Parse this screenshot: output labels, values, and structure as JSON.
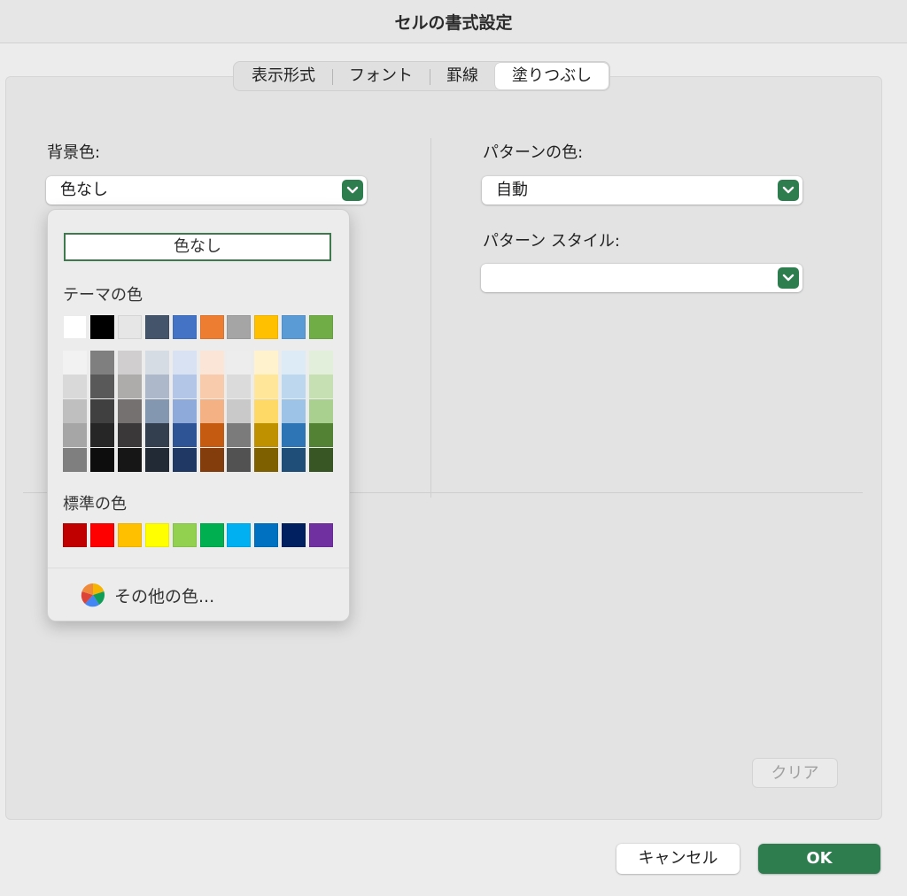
{
  "window": {
    "title": "セルの書式設定"
  },
  "tabs": [
    {
      "label": "表示形式",
      "active": false
    },
    {
      "label": "フォント",
      "active": false
    },
    {
      "label": "罫線",
      "active": false
    },
    {
      "label": "塗りつぶし",
      "active": true
    }
  ],
  "background_color": {
    "label": "背景色:",
    "value": "色なし",
    "popup": {
      "no_color_label": "色なし",
      "theme_colors_label": "テーマの色",
      "theme_colors": [
        "#ffffff",
        "#000000",
        "#e6e6e6",
        "#44546a",
        "#4472c4",
        "#ed7d31",
        "#a5a5a5",
        "#ffc000",
        "#5b9bd5",
        "#70ad47"
      ],
      "theme_shades": [
        [
          "#f2f2f2",
          "#d9d9d9",
          "#bfbfbf",
          "#a6a6a6",
          "#7f7f7f"
        ],
        [
          "#7f7f7f",
          "#595959",
          "#404040",
          "#262626",
          "#0d0d0d"
        ],
        [
          "#d0cece",
          "#aeabab",
          "#757171",
          "#3a3838",
          "#171616"
        ],
        [
          "#d6dce4",
          "#adb9ca",
          "#8497b0",
          "#333f4f",
          "#222a35"
        ],
        [
          "#d9e2f3",
          "#b4c6e7",
          "#8eaadb",
          "#2f5496",
          "#1f3864"
        ],
        [
          "#fbe5d6",
          "#f8cbad",
          "#f4b183",
          "#c55a11",
          "#833c0c"
        ],
        [
          "#ededed",
          "#dbdbdb",
          "#c9c9c9",
          "#7b7b7b",
          "#525252"
        ],
        [
          "#fff2cc",
          "#ffe699",
          "#ffd966",
          "#bf9000",
          "#7f6000"
        ],
        [
          "#ddebf7",
          "#bdd7ee",
          "#9dc3e6",
          "#2e75b6",
          "#1f4e79"
        ],
        [
          "#e2efda",
          "#c6e0b4",
          "#a9d08e",
          "#548235",
          "#375623"
        ]
      ],
      "standard_colors_label": "標準の色",
      "standard_colors": [
        "#c00000",
        "#ff0000",
        "#ffc000",
        "#ffff00",
        "#92d050",
        "#00b050",
        "#00b0f0",
        "#0070c0",
        "#002060",
        "#7030a0"
      ],
      "more_colors_label": "その他の色..."
    }
  },
  "pattern_color": {
    "label": "パターンの色:",
    "value": "自動"
  },
  "pattern_style": {
    "label": "パターン スタイル:",
    "value": ""
  },
  "buttons": {
    "clear": "クリア",
    "cancel": "キャンセル",
    "ok": "OK"
  },
  "colors": {
    "accent": "#2e7d4f"
  }
}
